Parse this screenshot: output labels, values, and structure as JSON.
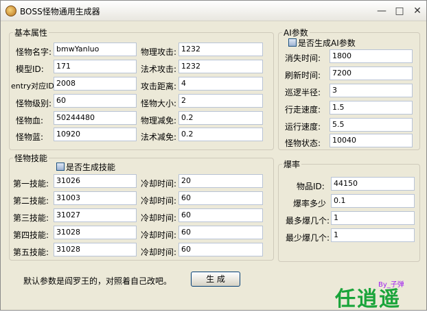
{
  "window": {
    "title": "BOSS怪物通用生成器",
    "min_icon": "minimize-icon",
    "max_icon": "maximize-icon",
    "close_icon": "close-icon"
  },
  "basic": {
    "group_title": "基本属性",
    "name_label": "怪物名字:",
    "name_value": "bmwYanluo",
    "model_label": "模型ID:",
    "model_value": "171",
    "entry_label": "entry对应ID",
    "entry_value": "2008",
    "level_label": "怪物级别:",
    "level_value": "60",
    "hp_label": "怪物血:",
    "hp_value": "50244480",
    "mp_label": "怪物蓝:",
    "mp_value": "10920",
    "patk_label": "物理攻击:",
    "patk_value": "1232",
    "matk_label": "法术攻击:",
    "matk_value": "1232",
    "range_label": "攻击距离:",
    "range_value": "4",
    "size_label": "怪物大小:",
    "size_value": "2",
    "pdef_label": "物理减免:",
    "pdef_value": "0.2",
    "mdef_label": "法术减免:",
    "mdef_value": "0.2"
  },
  "ai": {
    "group_title": "AI参数",
    "checkbox_label": "是否生成AI参数",
    "disappear_label": "消失时间:",
    "disappear_value": "1800",
    "refresh_label": "刷新时间:",
    "refresh_value": "7200",
    "patrol_label": "巡逻半径:",
    "patrol_value": "3",
    "walk_label": "行走速度:",
    "walk_value": "1.5",
    "run_label": "运行速度:",
    "run_value": "5.5",
    "state_label": "怪物状态:",
    "state_value": "10040"
  },
  "skills": {
    "group_title": "怪物技能",
    "checkbox_label": "是否生成技能",
    "cooldown_label": "冷却时间:",
    "rows": [
      {
        "label": "第一技能:",
        "id": "31026",
        "cd": "20"
      },
      {
        "label": "第二技能:",
        "id": "31003",
        "cd": "60"
      },
      {
        "label": "第三技能:",
        "id": "31027",
        "cd": "60"
      },
      {
        "label": "第四技能:",
        "id": "31028",
        "cd": "60"
      },
      {
        "label": "第五技能:",
        "id": "31028",
        "cd": "60"
      }
    ]
  },
  "drop": {
    "group_title": "爆率",
    "item_label": "物品ID:",
    "item_value": "44150",
    "rate_label": "爆率多少",
    "rate_value": "0.1",
    "max_label": "最多爆几个:",
    "max_value": "1",
    "min_label": "最少爆几个:",
    "min_value": "1"
  },
  "footer": {
    "note": "默认参数是阎罗王的，对照着自己改吧。",
    "generate_button": "生 成",
    "author": "By_子弹",
    "logo": "任逍遥"
  }
}
